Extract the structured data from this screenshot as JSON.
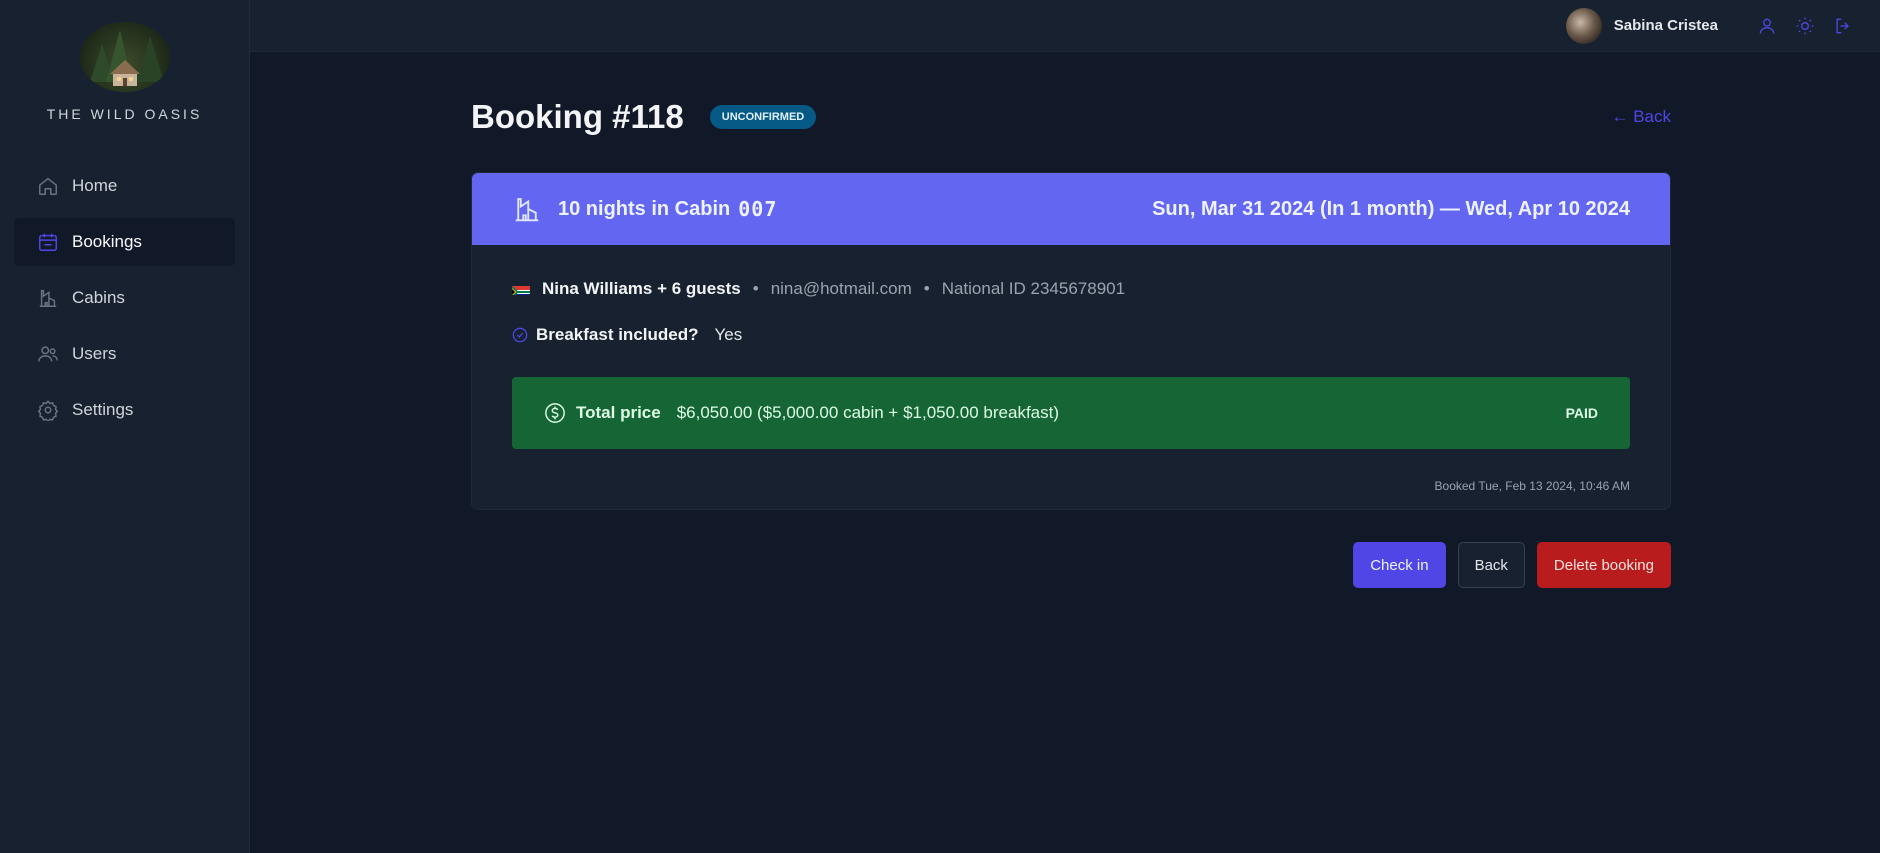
{
  "sidebar": {
    "brand": "THE WILD OASIS",
    "items": [
      {
        "label": "Home",
        "icon": "home-icon"
      },
      {
        "label": "Bookings",
        "icon": "calendar-icon",
        "active": true
      },
      {
        "label": "Cabins",
        "icon": "cabin-icon"
      },
      {
        "label": "Users",
        "icon": "users-icon"
      },
      {
        "label": "Settings",
        "icon": "gear-icon"
      }
    ]
  },
  "header": {
    "user_name": "Sabina Cristea",
    "actions": [
      "user-icon",
      "sun-icon",
      "logout-icon"
    ]
  },
  "booking": {
    "title": "Booking #118",
    "status": "UNCONFIRMED",
    "back_link": "← Back",
    "nights_text": "10 nights in Cabin",
    "cabin": "007",
    "dates": "Sun, Mar 31 2024 (In 1 month) — Wed, Apr 10 2024",
    "guest": "Nina Williams + 6 guests",
    "separator": "•",
    "email": "nina@hotmail.com",
    "national_id": "National ID 2345678901",
    "breakfast_label": "Breakfast included?",
    "breakfast_value": "Yes",
    "price_label": "Total price",
    "price_value": "$6,050.00 ($5,000.00 cabin + $1,050.00 breakfast)",
    "paid_status": "PAID",
    "booked_at": "Booked Tue, Feb 13 2024, 10:46 AM"
  },
  "actions": {
    "check_in": "Check in",
    "back": "Back",
    "delete": "Delete booking"
  },
  "colors": {
    "accent": "#4f46e5",
    "card_header": "#6366f1",
    "paid_bg": "#166534",
    "danger": "#b91c1c",
    "badge_bg": "#075985"
  }
}
